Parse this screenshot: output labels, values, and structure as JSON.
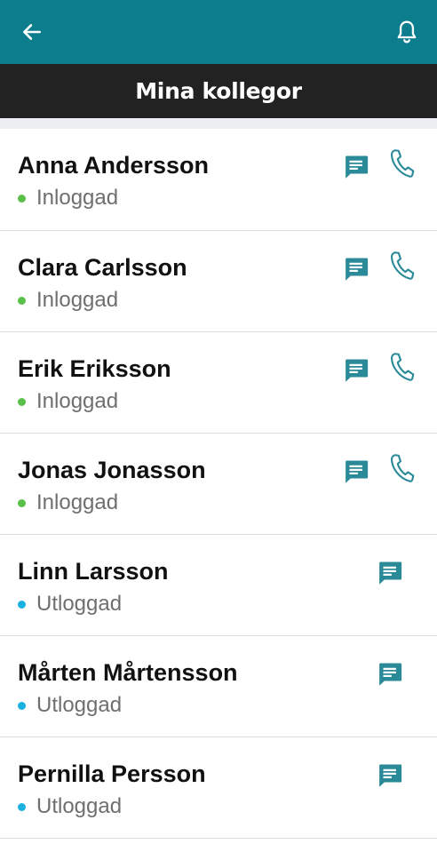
{
  "header": {
    "back_icon": "arrow-left-icon",
    "notifications_icon": "bell-icon",
    "title": "Mina kollegor"
  },
  "colors": {
    "topbar": "#0c7d8c",
    "titlebar": "#222222",
    "icon_teal": "#2a8a98",
    "online": "#5bc04a",
    "offline": "#1bb2e0"
  },
  "contacts": [
    {
      "name": "Anna Andersson",
      "status": "Inloggad",
      "online": true
    },
    {
      "name": "Clara Carlsson",
      "status": "Inloggad",
      "online": true
    },
    {
      "name": "Erik Eriksson",
      "status": "Inloggad",
      "online": true
    },
    {
      "name": "Jonas Jonasson",
      "status": "Inloggad",
      "online": true
    },
    {
      "name": "Linn Larsson",
      "status": "Utloggad",
      "online": false
    },
    {
      "name": "Mårten Mårtensson",
      "status": "Utloggad",
      "online": false
    },
    {
      "name": "Pernilla Persson",
      "status": "Utloggad",
      "online": false
    }
  ]
}
